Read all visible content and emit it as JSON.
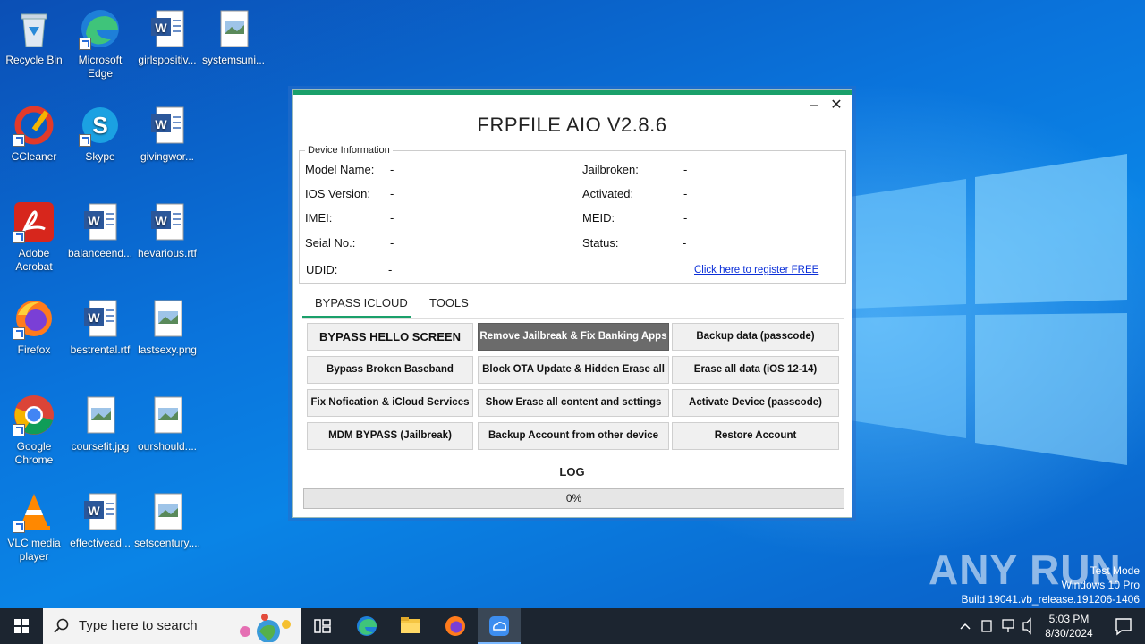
{
  "desktop": {
    "icons": [
      {
        "label": "Recycle Bin"
      },
      {
        "label": "Microsoft Edge"
      },
      {
        "label": "girlspositiv..."
      },
      {
        "label": "systemsuni..."
      },
      {
        "label": "CCleaner"
      },
      {
        "label": "Skype"
      },
      {
        "label": "givingwor..."
      },
      {
        "label": "Adobe Acrobat"
      },
      {
        "label": "balanceend..."
      },
      {
        "label": "hevarious.rtf"
      },
      {
        "label": "Firefox"
      },
      {
        "label": "bestrental.rtf"
      },
      {
        "label": "lastsexy.png"
      },
      {
        "label": "Google Chrome"
      },
      {
        "label": "coursefit.jpg"
      },
      {
        "label": "ourshould...."
      },
      {
        "label": "VLC media player"
      },
      {
        "label": "effectivead..."
      },
      {
        "label": "setscentury...."
      }
    ]
  },
  "app": {
    "title": "FRPFILE AIO V2.8.6",
    "minimize": "–",
    "close": "✕",
    "device_info": {
      "legend": "Device Information",
      "fields": [
        {
          "label": "Model Name:",
          "value": "-"
        },
        {
          "label": "IOS Version:",
          "value": "-"
        },
        {
          "label": "IMEI:",
          "value": "-"
        },
        {
          "label": "Seial No.:",
          "value": "-"
        },
        {
          "label": "UDID:",
          "value": "-"
        },
        {
          "label": "Jailbroken:",
          "value": "-"
        },
        {
          "label": "Activated:",
          "value": "-"
        },
        {
          "label": "MEID:",
          "value": "-"
        },
        {
          "label": "Status:",
          "value": "-"
        }
      ],
      "register_link": "Click here to register FREE"
    },
    "tabs": [
      {
        "label": "BYPASS ICLOUD",
        "active": true
      },
      {
        "label": "TOOLS",
        "active": false
      }
    ],
    "buttons": {
      "bypass_hello": "BYPASS HELLO SCREEN",
      "remove_jailbreak": "Remove Jailbreak & Fix Banking Apps",
      "backup_data": "Backup data (passcode)",
      "bypass_baseband": "Bypass Broken Baseband",
      "block_ota": "Block OTA Update & Hidden Erase all",
      "erase_all": "Erase all data (iOS 12-14)",
      "fix_notification": "Fix Nofication & iCloud Services",
      "show_erase": "Show Erase all content and settings",
      "activate_device": "Activate Device (passcode)",
      "mdm_bypass": "MDM BYPASS (Jailbreak)",
      "backup_account": "Backup Account from other device",
      "restore_account": "Restore Account"
    },
    "log_label": "LOG",
    "progress": {
      "value": 0,
      "text": "0%"
    }
  },
  "watermark": {
    "brand": "ANY RUN",
    "line1": "Test Mode",
    "line2": "Windows 10 Pro",
    "line3": "Build 19041.vb_release.191206-1406"
  },
  "taskbar": {
    "search_placeholder": "Type here to search",
    "time": "5:03 PM",
    "date": "8/30/2024"
  },
  "colors": {
    "accent_green": "#1aa06a",
    "dark_button": "#6b6b6b",
    "taskbar": "#1c2530"
  }
}
